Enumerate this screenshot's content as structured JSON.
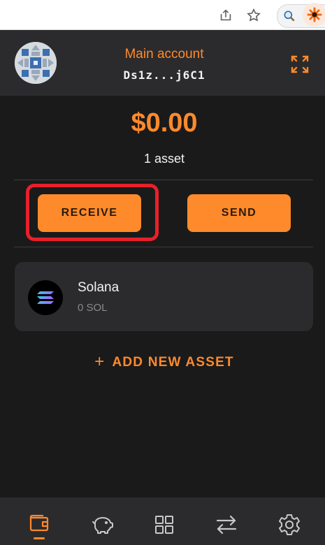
{
  "header": {
    "account_name": "Main account",
    "address": "Ds1z...j6C1"
  },
  "balance": {
    "total": "$0.00",
    "asset_count": "1 asset"
  },
  "actions": {
    "receive_label": "RECEIVE",
    "send_label": "SEND"
  },
  "assets": [
    {
      "name": "Solana",
      "amount": "0 SOL",
      "icon": "solana-icon"
    }
  ],
  "add_asset": {
    "plus": "+",
    "label": "ADD NEW ASSET"
  },
  "nav": {
    "items": [
      "wallet-icon",
      "piggy-bank-icon",
      "apps-grid-icon",
      "swap-icon",
      "gear-icon"
    ],
    "active": "wallet-icon"
  },
  "colors": {
    "accent": "#ff8a2b",
    "background": "#1a1a1b",
    "surface": "#2b2b2d",
    "highlight": "#e8202a"
  }
}
